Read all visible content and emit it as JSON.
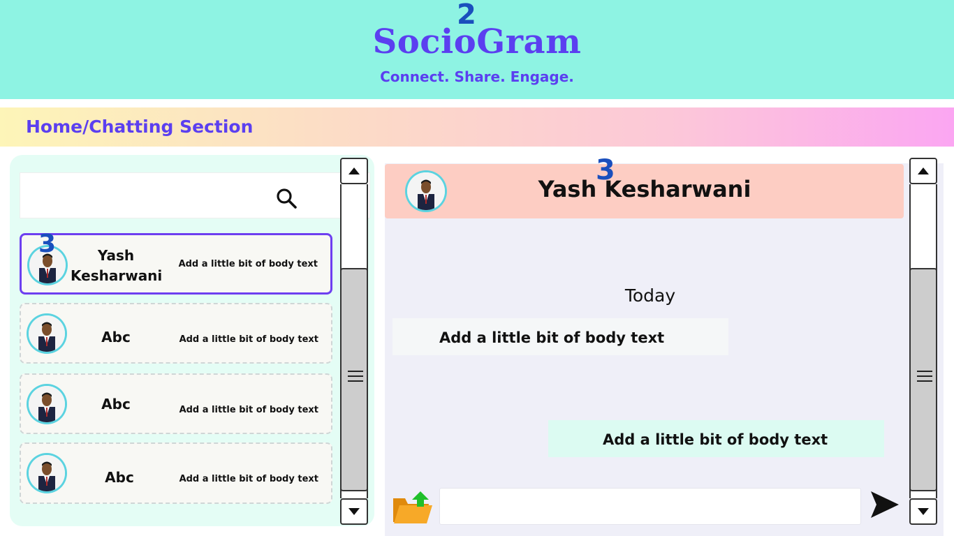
{
  "header": {
    "badge": "2",
    "brand": "SocioGram",
    "tagline": "Connect. Share. Engage."
  },
  "breadcrumb": "Home/Chatting Section",
  "search": {
    "value": "",
    "placeholder": ""
  },
  "contacts": [
    {
      "badge": "3",
      "name": "Yash Kesharwani",
      "preview": "Add a little bit of body text"
    },
    {
      "name": "Abc",
      "preview": "Add a little bit of body text"
    },
    {
      "name": "Abc",
      "preview": "Add a little bit of body text"
    },
    {
      "name": "Abc",
      "preview": "Add a little bit of body text"
    }
  ],
  "chat": {
    "badge": "3",
    "contact_name": "Yash Kesharwani",
    "day_label": "Today",
    "messages": [
      {
        "direction": "in",
        "text": "Add a little bit of body text"
      },
      {
        "direction": "out",
        "text": "Add a little bit of body text"
      }
    ],
    "input": {
      "value": "",
      "placeholder": ""
    }
  },
  "icons": {
    "search": "search-icon",
    "upload": "folder-upload-icon",
    "send": "send-icon",
    "scroll_up": "triangle-up-icon",
    "scroll_down": "triangle-down-icon",
    "grip": "menu-grip-icon"
  },
  "colors": {
    "header_bg": "#8ef3e3",
    "brand": "#5b3ff0",
    "badge": "#1a4fbd",
    "active_border": "#6d3ff0",
    "chat_header_bg": "#fdcdc3",
    "incoming_bubble": "#f5f7f8",
    "outgoing_bubble": "#dcfbf2"
  }
}
